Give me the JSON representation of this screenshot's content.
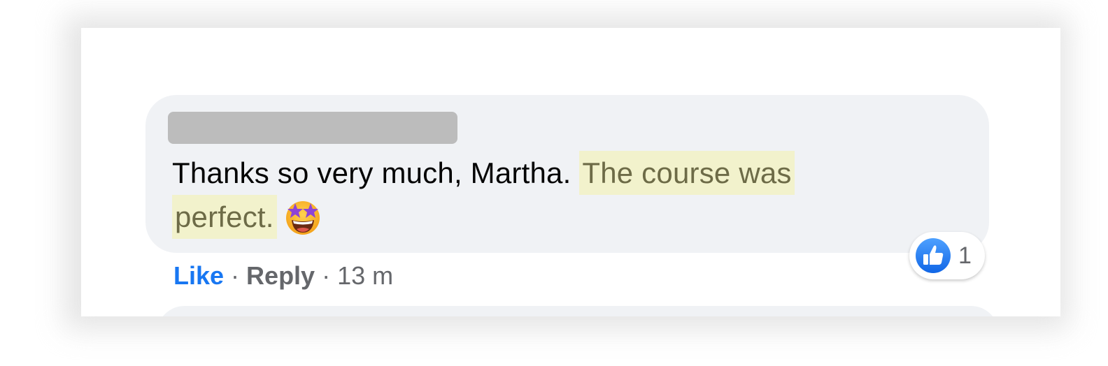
{
  "comment": {
    "text_plain": "Thanks so very much, Martha. ",
    "text_highlight_1": "The course was",
    "text_highlight_2": "perfect.",
    "emoji": "star-struck-emoji"
  },
  "reactions": {
    "icon": "thumbs-up-icon",
    "count": "1",
    "like_color": "#1877f2"
  },
  "actions": {
    "like": "Like",
    "separator": "·",
    "reply": "Reply",
    "timestamp": "13 m"
  },
  "colors": {
    "bubble": "#f0f2f5",
    "highlight": "#f2f2cc",
    "redaction": "#bcbcbc"
  }
}
